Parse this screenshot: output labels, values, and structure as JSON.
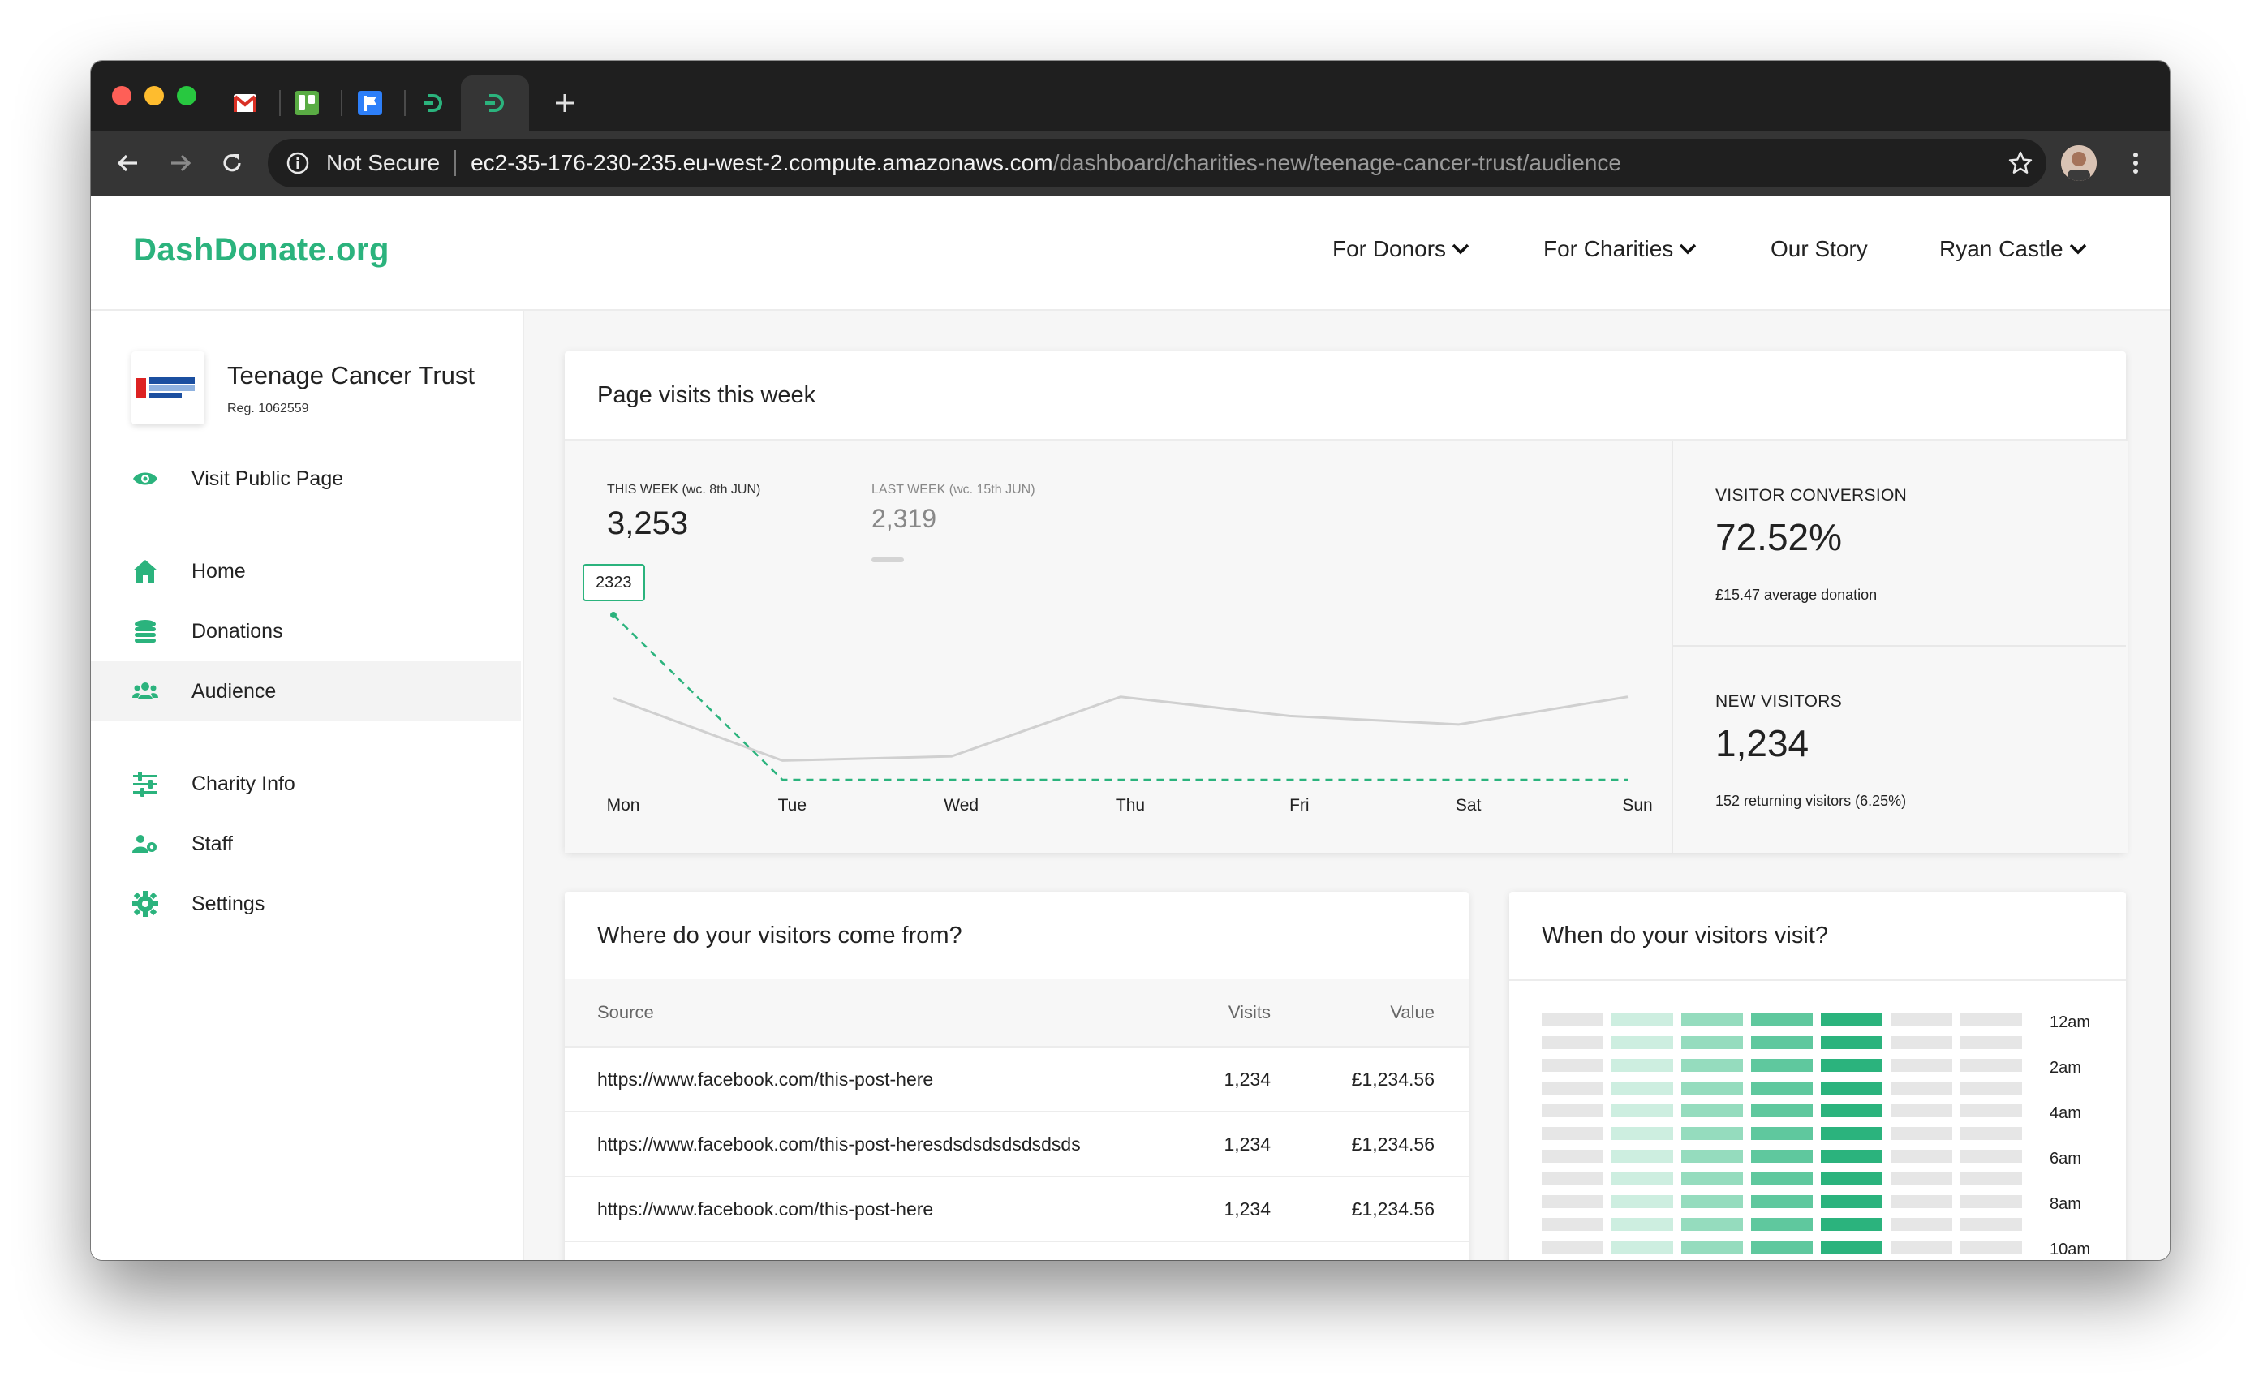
{
  "browser": {
    "tabs": [
      {
        "name": "gmail-tab",
        "icon": "gmail-icon"
      },
      {
        "name": "trello-tab",
        "icon": "trello-icon"
      },
      {
        "name": "flag-tab",
        "icon": "flag-icon"
      },
      {
        "name": "dashdonate-tab-1",
        "icon": "dashdonate-icon"
      },
      {
        "name": "dashdonate-tab-2",
        "icon": "dashdonate-icon"
      }
    ],
    "security_label": "Not Secure",
    "url_host": "ec2-35-176-230-235.eu-west-2.compute.amazonaws.com",
    "url_path": "/dashboard/charities-new/teenage-cancer-trust/audience"
  },
  "header": {
    "logo": "DashDonate.org",
    "nav": [
      "For Donors",
      "For Charities",
      "Our Story",
      "Ryan Castle"
    ]
  },
  "sidebar": {
    "charity_name": "Teenage Cancer Trust",
    "charity_reg": "Reg. 1062559",
    "items": [
      {
        "label": "Visit Public Page",
        "icon": "eye-icon"
      },
      {
        "label": "Home",
        "icon": "home-icon"
      },
      {
        "label": "Donations",
        "icon": "coins-icon"
      },
      {
        "label": "Audience",
        "icon": "users-icon"
      },
      {
        "label": "Charity Info",
        "icon": "sliders-icon"
      },
      {
        "label": "Staff",
        "icon": "staff-icon"
      },
      {
        "label": "Settings",
        "icon": "gear-icon"
      }
    ],
    "active": "Audience"
  },
  "visits": {
    "title": "Page visits this week",
    "this_week_label": "THIS WEEK (wc. 8th JUN)",
    "this_week_value": "3,253",
    "last_week_label": "LAST WEEK (wc. 15th JUN)",
    "last_week_value": "2,319",
    "tooltip": "2323",
    "conversion_label": "VISITOR CONVERSION",
    "conversion_value": "72.52%",
    "conversion_sub": "£15.47 average donation",
    "new_visitors_label": "NEW VISITORS",
    "new_visitors_value": "1,234",
    "new_visitors_sub": "152 returning visitors (6.25%)"
  },
  "chart_data": {
    "type": "line",
    "categories": [
      "Mon",
      "Tue",
      "Wed",
      "Thu",
      "Fri",
      "Sat",
      "Sun"
    ],
    "series": [
      {
        "name": "THIS WEEK (wc. 8th JUN)",
        "values": [
          2323,
          0,
          0,
          0,
          0,
          0,
          0
        ],
        "color": "#2bb37d",
        "style": "dashed"
      },
      {
        "name": "LAST WEEK (wc. 15th JUN)",
        "values": [
          1150,
          270,
          330,
          1170,
          900,
          780,
          1170
        ],
        "color": "#d0d0d0",
        "style": "solid"
      }
    ],
    "ylim": [
      0,
      2323
    ]
  },
  "sources": {
    "title": "Where do your visitors come from?",
    "columns": [
      "Source",
      "Visits",
      "Value"
    ],
    "rows": [
      [
        "https://www.facebook.com/this-post-here",
        "1,234",
        "£1,234.56"
      ],
      [
        "https://www.facebook.com/this-post-heresdsdsdsdsdsdsds",
        "1,234",
        "£1,234.56"
      ],
      [
        "https://www.facebook.com/this-post-here",
        "1,234",
        "£1,234.56"
      ]
    ]
  },
  "times": {
    "title": "When do your visitors visit?",
    "hour_labels": [
      "12am",
      "2am",
      "4am",
      "6am",
      "8am",
      "10am"
    ],
    "column_colors": [
      "#e6e6e6",
      "#cdeee0",
      "#95dcbe",
      "#5fc89e",
      "#2bb37d",
      "#e6e6e6",
      "#e6e6e6"
    ]
  }
}
